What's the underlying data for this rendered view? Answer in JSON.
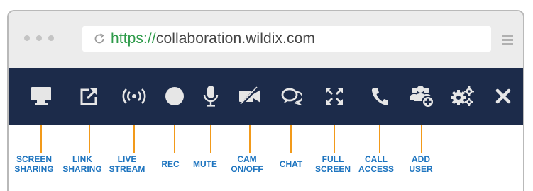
{
  "browser": {
    "url_scheme": "https://",
    "url_host": "collaboration.wildix.com",
    "window_dots": [
      "dot",
      "dot",
      "dot"
    ],
    "reload_icon": "reload-icon",
    "menu_icon": "hamburger-menu-icon"
  },
  "toolbar": {
    "background": "#1c2b4a",
    "icon_color": "#e6e6e6",
    "buttons": [
      {
        "id": "screen-sharing",
        "icon": "monitor-icon",
        "label": "SCREEN\nSHARING"
      },
      {
        "id": "link-sharing",
        "icon": "external-link-icon",
        "label": "LINK\nSHARING"
      },
      {
        "id": "live-stream",
        "icon": "broadcast-icon",
        "label": "LIVE\nSTREAM"
      },
      {
        "id": "rec",
        "icon": "record-icon",
        "label": "REC"
      },
      {
        "id": "mute",
        "icon": "microphone-icon",
        "label": "MUTE"
      },
      {
        "id": "cam-onoff",
        "icon": "camera-off-icon",
        "label": "CAM\nON/OFF"
      },
      {
        "id": "chat",
        "icon": "chat-bubbles-icon",
        "label": "CHAT"
      },
      {
        "id": "full-screen",
        "icon": "fullscreen-arrows-icon",
        "label": "FULL\nSCREEN"
      },
      {
        "id": "call-access",
        "icon": "phone-icon",
        "label": "CALL\nACCESS"
      },
      {
        "id": "add-user",
        "icon": "add-user-icon",
        "label": "ADD\nUSER"
      },
      {
        "id": "settings",
        "icon": "gears-icon",
        "label": ""
      },
      {
        "id": "close",
        "icon": "close-icon",
        "label": ""
      }
    ]
  },
  "callout_color": "#f29a1a",
  "label_color": "#1d74bf"
}
